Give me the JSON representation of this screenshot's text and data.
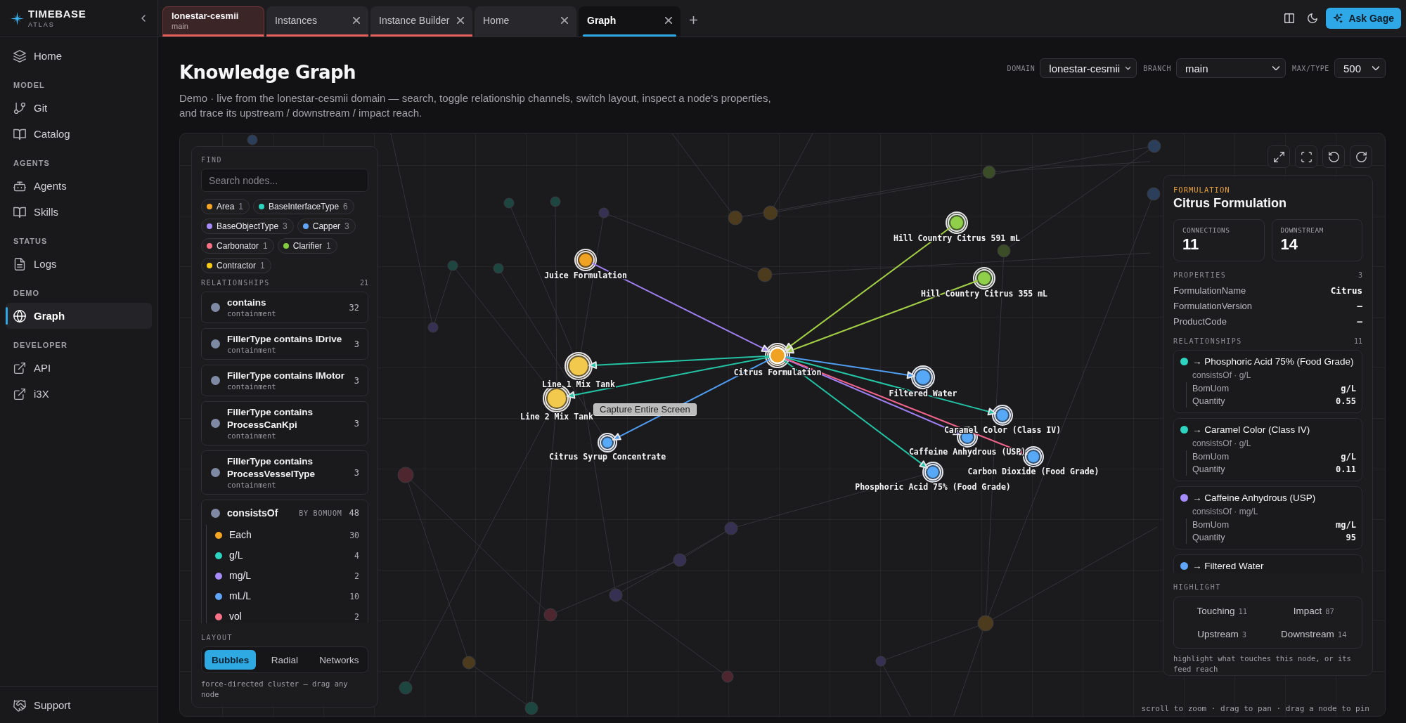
{
  "brand": {
    "name": "TIMEBASE",
    "subtitle": "ATLAS"
  },
  "sidebar": {
    "sections": [
      {
        "items": [
          {
            "label": "Home",
            "selected": false
          }
        ]
      },
      {
        "heading": "MODEL",
        "items": [
          {
            "label": "Git",
            "selected": false
          },
          {
            "label": "Catalog",
            "selected": false
          }
        ]
      },
      {
        "heading": "AGENTS",
        "items": [
          {
            "label": "Agents",
            "selected": false
          },
          {
            "label": "Skills",
            "selected": false
          }
        ]
      },
      {
        "heading": "STATUS",
        "items": [
          {
            "label": "Logs",
            "selected": false
          }
        ]
      },
      {
        "heading": "DEMO",
        "items": [
          {
            "label": "Graph",
            "selected": true
          }
        ]
      },
      {
        "heading": "DEVELOPER",
        "items": [
          {
            "label": "API",
            "selected": false
          },
          {
            "label": "i3X",
            "selected": false
          }
        ]
      }
    ],
    "footer": {
      "label": "Support"
    }
  },
  "tabs": [
    {
      "kind": "workspace",
      "label": "lonestar-cesmii",
      "sublabel": "main",
      "grouped": true,
      "selected": false
    },
    {
      "kind": "page",
      "label": "Instances",
      "grouped": true,
      "selected": false
    },
    {
      "kind": "page",
      "label": "Instance Builder",
      "grouped": true,
      "selected": false
    },
    {
      "kind": "page",
      "label": "Home",
      "grouped": false,
      "selected": false
    },
    {
      "kind": "page",
      "label": "Graph",
      "grouped": false,
      "selected": true
    }
  ],
  "actions": {
    "ask_button": "Ask Gage"
  },
  "page": {
    "title": "Knowledge Graph",
    "description": "Demo · live from the lonestar-cesmii domain — search, toggle relationship channels, switch layout, inspect a node's properties, and trace its upstream / downstream / impact reach.",
    "filters": [
      {
        "label": "DOMAIN",
        "value": "lonestar-cesmii"
      },
      {
        "label": "BRANCH",
        "value": "main"
      },
      {
        "label": "MAX/TYPE",
        "value": "500"
      }
    ]
  },
  "graph": {
    "find": {
      "label": "FIND",
      "placeholder": "Search nodes..."
    },
    "types": [
      {
        "name": "Area",
        "count": "1",
        "color": "#f5a524"
      },
      {
        "name": "BaseInterfaceType",
        "count": "6",
        "color": "#2dd4bf"
      },
      {
        "name": "BaseObjectType",
        "count": "3",
        "color": "#a78bfa"
      },
      {
        "name": "Capper",
        "count": "3",
        "color": "#60a5fa"
      },
      {
        "name": "Carbonator",
        "count": "1",
        "color": "#fb7185"
      },
      {
        "name": "Clarifier",
        "count": "1",
        "color": "#84cc3f"
      },
      {
        "name": "Contractor",
        "count": "1",
        "color": "#facc15"
      }
    ],
    "relationships": {
      "label": "RELATIONSHIPS",
      "count": "21",
      "items": [
        {
          "kind": "channel",
          "name": "contains",
          "category": "containment",
          "count": "32"
        },
        {
          "kind": "channel",
          "name": "FillerType contains IDrive",
          "category": "containment",
          "count": "3"
        },
        {
          "kind": "channel",
          "name": "FillerType contains IMotor",
          "category": "containment",
          "count": "3"
        },
        {
          "kind": "channel",
          "name": "FillerType contains ProcessCanKpi",
          "category": "containment",
          "count": "3"
        },
        {
          "kind": "channel",
          "name": "FillerType contains ProcessVesselType",
          "category": "containment",
          "count": "3"
        },
        {
          "kind": "grouped",
          "name": "consistsOf",
          "breakdown": "BY BOMUOM",
          "count": "48",
          "children": [
            {
              "name": "Each",
              "count": "30",
              "color": "#f5a524"
            },
            {
              "name": "g/L",
              "count": "4",
              "color": "#2dd4bf"
            },
            {
              "name": "mg/L",
              "count": "2",
              "color": "#a78bfa"
            },
            {
              "name": "mL/L",
              "count": "10",
              "color": "#60a5fa"
            },
            {
              "name": "vol",
              "count": "2",
              "color": "#fb7185"
            }
          ]
        }
      ]
    },
    "layout": {
      "label": "LAYOUT",
      "options": [
        {
          "label": "Bubbles",
          "selected": true
        },
        {
          "label": "Radial",
          "selected": false
        },
        {
          "label": "Networks",
          "selected": false
        }
      ],
      "hint": "force-directed cluster — drag any node"
    },
    "nodes": [
      {
        "label": "Citrus Formulation",
        "color": "#f0a323",
        "selected": true
      },
      {
        "label": "Juice Formulation",
        "color": "#f0a323",
        "selected": false,
        "edge": {
          "kind": "incoming",
          "color": "#9d7ff0"
        }
      },
      {
        "label": "Hill Country Citrus 591 mL",
        "color": "#8fcf4a",
        "selected": false,
        "edge": {
          "kind": "incoming",
          "color": "#a3cf45"
        }
      },
      {
        "label": "Hill Country Citrus 355 mL",
        "color": "#8fcf4a",
        "selected": false,
        "edge": {
          "kind": "incoming",
          "color": "#a3cf45"
        }
      },
      {
        "label": "Line 1 Mix Tank",
        "color": "#f2c94c",
        "selected": false,
        "edge": {
          "kind": "outgoing",
          "color": "#23c4a4"
        }
      },
      {
        "label": "Line 2 Mix Tank",
        "color": "#f2c94c",
        "selected": false,
        "edge": {
          "kind": "outgoing",
          "color": "#23c4a4"
        }
      },
      {
        "label": "Citrus Syrup Concentrate",
        "color": "#57a8f7",
        "selected": false,
        "edge": {
          "kind": "outgoing",
          "color": "#4f9ef2"
        }
      },
      {
        "label": "Filtered Water",
        "color": "#57a8f7",
        "selected": false,
        "edge": {
          "kind": "outgoing",
          "color": "#4f9ef2"
        }
      },
      {
        "label": "Caramel Color (Class IV)",
        "color": "#57a8f7",
        "selected": false,
        "edge": {
          "kind": "outgoing",
          "color": "#23c4a4"
        }
      },
      {
        "label": "Caffeine Anhydrous (USP)",
        "color": "#57a8f7",
        "selected": false,
        "edge": {
          "kind": "outgoing",
          "color": "#9d7ff0"
        }
      },
      {
        "label": "Carbon Dioxide (Food Grade)",
        "color": "#57a8f7",
        "selected": false,
        "edge": {
          "kind": "outgoing",
          "color": "#f0648c"
        }
      },
      {
        "label": "Phosphoric Acid 75% (Food Grade)",
        "color": "#57a8f7",
        "selected": false,
        "edge": {
          "kind": "outgoing",
          "color": "#23c4a4"
        }
      }
    ],
    "background_nodes": [
      {
        "color": "#2b3f5a"
      },
      {
        "color": "#1d4640"
      },
      {
        "color": "#1d4640"
      },
      {
        "color": "#363152"
      },
      {
        "color": "#1d4640"
      },
      {
        "color": "#1d4640"
      },
      {
        "color": "#363152"
      },
      {
        "color": "#4d3b1e"
      },
      {
        "color": "#4d3b1e"
      },
      {
        "color": "#4d3b1e"
      },
      {
        "color": "#3a4d26"
      },
      {
        "color": "#3a4d26"
      },
      {
        "color": "#2b3f5a"
      },
      {
        "color": "#2b3f5a"
      },
      {
        "color": "#4d2630"
      },
      {
        "color": "#363152"
      },
      {
        "color": "#363152"
      },
      {
        "color": "#363152"
      },
      {
        "color": "#4d2630"
      },
      {
        "color": "#4d3b1e"
      },
      {
        "color": "#363152"
      },
      {
        "color": "#4d2630"
      },
      {
        "color": "#4d3b1e"
      },
      {
        "color": "#1d4640"
      },
      {
        "color": "#1d4640"
      }
    ],
    "tooltip": "Capture Entire Screen",
    "hint": "scroll to zoom · drag to pan · drag a node to pin",
    "details": {
      "type": "FORMULATION",
      "title": "Citrus Formulation",
      "stats": [
        {
          "label": "CONNECTIONS",
          "value": "11"
        },
        {
          "label": "DOWNSTREAM",
          "value": "14"
        }
      ],
      "properties": {
        "label": "PROPERTIES",
        "count": "3",
        "rows": [
          {
            "key": "FormulationName",
            "value": "Citrus"
          },
          {
            "key": "FormulationVersion",
            "value": "—"
          },
          {
            "key": "ProductCode",
            "value": "—"
          }
        ]
      },
      "relationships": {
        "label": "RELATIONSHIPS",
        "count": "11",
        "items": [
          {
            "target": "→ Phosphoric Acid 75% (Food Grade)",
            "color": "#2dd4bf",
            "via": "consistsOf · g/L",
            "props": [
              {
                "key": "BomUom",
                "value": "g/L"
              },
              {
                "key": "Quantity",
                "value": "0.55"
              }
            ]
          },
          {
            "target": "→ Caramel Color (Class IV)",
            "color": "#2dd4bf",
            "via": "consistsOf · g/L",
            "props": [
              {
                "key": "BomUom",
                "value": "g/L"
              },
              {
                "key": "Quantity",
                "value": "0.11"
              }
            ]
          },
          {
            "target": "→ Caffeine Anhydrous (USP)",
            "color": "#a78bfa",
            "via": "consistsOf · mg/L",
            "props": [
              {
                "key": "BomUom",
                "value": "mg/L"
              },
              {
                "key": "Quantity",
                "value": "95"
              }
            ]
          },
          {
            "target": "→ Filtered Water",
            "color": "#60a5fa"
          }
        ]
      },
      "highlight": {
        "label": "HIGHLIGHT",
        "options": [
          {
            "label": "Touching",
            "count": "11",
            "selected": false
          },
          {
            "label": "Impact",
            "count": "87",
            "selected": false
          },
          {
            "label": "Upstream",
            "count": "3",
            "selected": false
          },
          {
            "label": "Downstream",
            "count": "14",
            "selected": false
          }
        ],
        "hint": "highlight what touches this node, or its feed reach"
      }
    }
  }
}
